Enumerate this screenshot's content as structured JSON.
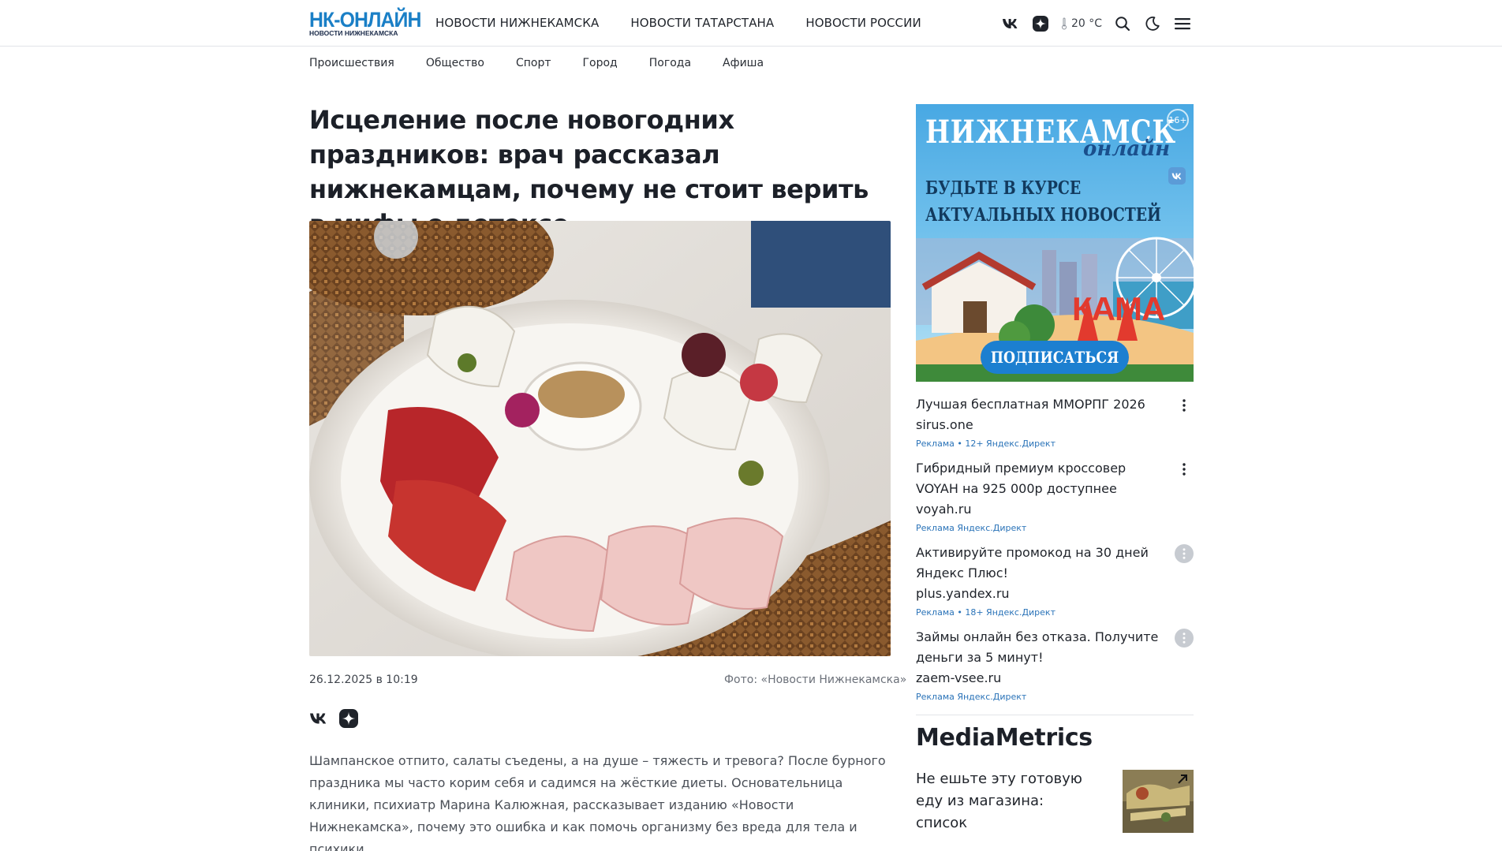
{
  "header": {
    "logo_main": "НК-ОНЛАЙН",
    "logo_sub": "НОВОСТИ НИЖНЕКАМСКА",
    "nav": [
      "НОВОСТИ НИЖНЕКАМСКА",
      "НОВОСТИ ТАТАРСТАНА",
      "НОВОСТИ РОССИИ"
    ],
    "weather": "20 °C",
    "icons": [
      "vk-icon",
      "dzen-icon",
      "thermometer-icon",
      "search-icon",
      "moon-icon",
      "menu-icon"
    ]
  },
  "subnav": [
    "Происшествия",
    "Общество",
    "Спорт",
    "Город",
    "Погода",
    "Афиша"
  ],
  "article": {
    "title": "Исцеление после новогодних праздников: врач рассказал нижнекамцам, почему не стоит верить в мифы о детоксе",
    "date": "26.12.2025 в 10:19",
    "photo_credit": "Фото: «Новости Нижнекамска»",
    "lead": "Шампанское отпито, салаты съедены, а на душе – тяжесть и тревога? После бурного праздника мы часто корим себя и садимся на жёсткие диеты. Основательница клиники, психиатр Марина Калюжная, рассказывает изданию «Новости Нижнекамска», почему это ошибка и как помочь организму без вреда для тела и психики."
  },
  "banner": {
    "title": "НИЖНЕКАМСК",
    "script": "онлайн",
    "age": "16+",
    "line1": "БУДЬТЕ В КУРСЕ",
    "line2": "АКТУАЛЬНЫХ НОВОСТЕЙ",
    "sign": "КАМА",
    "button": "ПОДПИСАТЬСЯ"
  },
  "ads": [
    {
      "title": "Лучшая бесплатная ММОРПГ 2026",
      "domain": "sirus.one",
      "label": "Реклама • 12+ Яндекс.Директ",
      "menu_filled": false
    },
    {
      "title": "Гибридный премиум кроссовер VOYAH на 925 000р доступнее",
      "domain": "voyah.ru",
      "label": "Реклама Яндекс.Директ",
      "menu_filled": false
    },
    {
      "title": "Активируйте промокод на 30 дней Яндекс Плюс!",
      "domain": "plus.yandex.ru",
      "label": "Реклама • 18+ Яндекс.Директ",
      "menu_filled": true
    },
    {
      "title": "Займы онлайн без отказа. Получите деньги за 5 минут!",
      "domain": "zaem-vsee.ru",
      "label": "Реклама Яндекс.Директ",
      "menu_filled": true
    }
  ],
  "mediametrics": {
    "heading": "MediaMetrics",
    "item_text": "Не ешьте эту готовую еду из магазина: список"
  },
  "colors": {
    "accent": "#1a7fc6",
    "ad_label": "#2a73b8",
    "text": "#1f232a"
  }
}
